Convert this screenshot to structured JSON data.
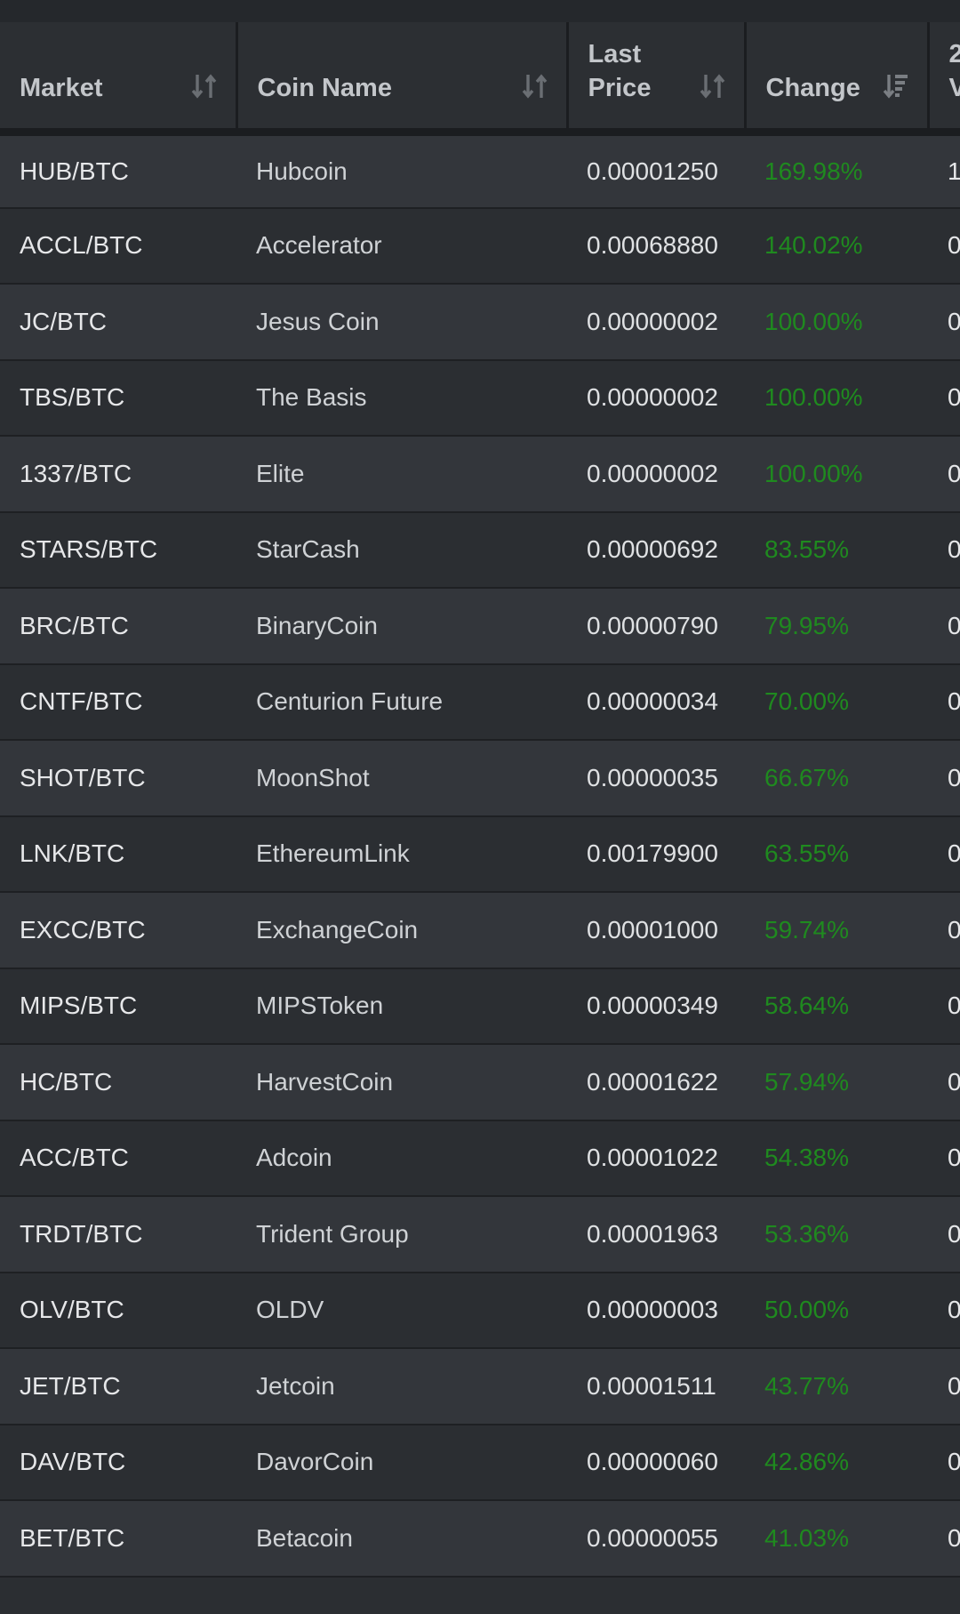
{
  "table": {
    "headers": {
      "market": "Market",
      "coin_name": "Coin Name",
      "last_price_line1": "Last",
      "last_price_line2": "Price",
      "change": "Change",
      "volume_line1": "2",
      "volume_line2": "V"
    },
    "rows": [
      {
        "market": "HUB/BTC",
        "coin": "Hubcoin",
        "price": "0.00001250",
        "change": "169.98%",
        "vol": "1"
      },
      {
        "market": "ACCL/BTC",
        "coin": "Accelerator",
        "price": "0.00068880",
        "change": "140.02%",
        "vol": "0"
      },
      {
        "market": "JC/BTC",
        "coin": "Jesus Coin",
        "price": "0.00000002",
        "change": "100.00%",
        "vol": "0"
      },
      {
        "market": "TBS/BTC",
        "coin": "The Basis",
        "price": "0.00000002",
        "change": "100.00%",
        "vol": "0"
      },
      {
        "market": "1337/BTC",
        "coin": "Elite",
        "price": "0.00000002",
        "change": "100.00%",
        "vol": "0"
      },
      {
        "market": "STARS/BTC",
        "coin": "StarCash",
        "price": "0.00000692",
        "change": "83.55%",
        "vol": "0"
      },
      {
        "market": "BRC/BTC",
        "coin": "BinaryCoin",
        "price": "0.00000790",
        "change": "79.95%",
        "vol": "0"
      },
      {
        "market": "CNTF/BTC",
        "coin": "Centurion Future",
        "price": "0.00000034",
        "change": "70.00%",
        "vol": "0"
      },
      {
        "market": "SHOT/BTC",
        "coin": "MoonShot",
        "price": "0.00000035",
        "change": "66.67%",
        "vol": "0"
      },
      {
        "market": "LNK/BTC",
        "coin": "EthereumLink",
        "price": "0.00179900",
        "change": "63.55%",
        "vol": "0"
      },
      {
        "market": "EXCC/BTC",
        "coin": "ExchangeCoin",
        "price": "0.00001000",
        "change": "59.74%",
        "vol": "0"
      },
      {
        "market": "MIPS/BTC",
        "coin": "MIPSToken",
        "price": "0.00000349",
        "change": "58.64%",
        "vol": "0"
      },
      {
        "market": "HC/BTC",
        "coin": "HarvestCoin",
        "price": "0.00001622",
        "change": "57.94%",
        "vol": "0"
      },
      {
        "market": "ACC/BTC",
        "coin": "Adcoin",
        "price": "0.00001022",
        "change": "54.38%",
        "vol": "0"
      },
      {
        "market": "TRDT/BTC",
        "coin": "Trident Group",
        "price": "0.00001963",
        "change": "53.36%",
        "vol": "0"
      },
      {
        "market": "OLV/BTC",
        "coin": "OLDV",
        "price": "0.00000003",
        "change": "50.00%",
        "vol": "0"
      },
      {
        "market": "JET/BTC",
        "coin": "Jetcoin",
        "price": "0.00001511",
        "change": "43.77%",
        "vol": "0"
      },
      {
        "market": "DAV/BTC",
        "coin": "DavorCoin",
        "price": "0.00000060",
        "change": "42.86%",
        "vol": "0"
      },
      {
        "market": "BET/BTC",
        "coin": "Betacoin",
        "price": "0.00000055",
        "change": "41.03%",
        "vol": "0"
      }
    ]
  },
  "colors": {
    "background": "#2b2e32",
    "row_alt": "#33363b",
    "positive_change": "#1f8a1f",
    "header_text": "#c3c6ca"
  },
  "icons": {
    "sort": "sort-arrows-icon",
    "sort_desc": "sort-descending-icon"
  }
}
